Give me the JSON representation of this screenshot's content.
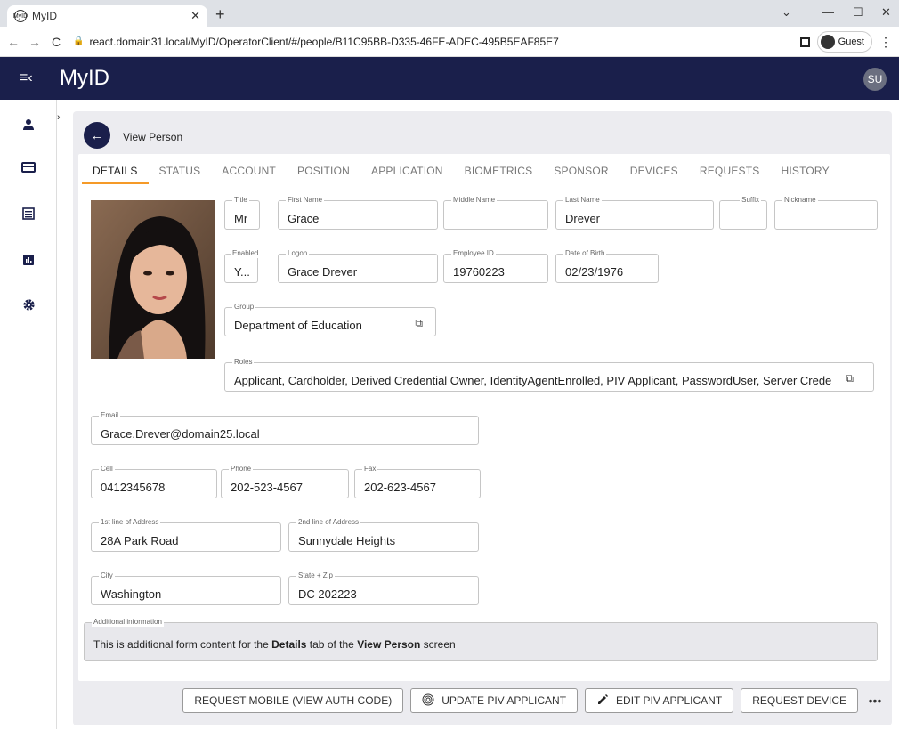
{
  "browser": {
    "tab_title": "MyID",
    "favicon_text": "MyID",
    "url": "react.domain31.local/MyID/OperatorClient/#/people/B11C95BB-D335-46FE-ADEC-495B5EAF85E7",
    "profile_label": "Guest"
  },
  "appbar": {
    "brand": "MyID",
    "user_initials": "SU"
  },
  "page": {
    "title": "View Person"
  },
  "tabs": [
    "DETAILS",
    "STATUS",
    "ACCOUNT",
    "POSITION",
    "APPLICATION",
    "BIOMETRICS",
    "SPONSOR",
    "DEVICES",
    "REQUESTS",
    "HISTORY"
  ],
  "fields": {
    "title": {
      "label": "Title",
      "value": "Mr"
    },
    "first_name": {
      "label": "First Name",
      "value": "Grace"
    },
    "middle_name": {
      "label": "Middle Name",
      "value": ""
    },
    "last_name": {
      "label": "Last Name",
      "value": "Drever"
    },
    "suffix": {
      "label": "Suffix",
      "value": ""
    },
    "nickname": {
      "label": "Nickname",
      "value": ""
    },
    "enabled": {
      "label": "Enabled",
      "value": "Y..."
    },
    "logon": {
      "label": "Logon",
      "value": "Grace Drever"
    },
    "employee_id": {
      "label": "Employee ID",
      "value": "19760223"
    },
    "dob": {
      "label": "Date of Birth",
      "value": "02/23/1976"
    },
    "group": {
      "label": "Group",
      "value": "Department of Education"
    },
    "roles": {
      "label": "Roles",
      "value": "Applicant, Cardholder, Derived Credential Owner, IdentityAgentEnrolled, PIV Applicant, PasswordUser, Server Crede"
    },
    "email": {
      "label": "Email",
      "value": "Grace.Drever@domain25.local"
    },
    "cell": {
      "label": "Cell",
      "value": "0412345678"
    },
    "phone": {
      "label": "Phone",
      "value": "202-523-4567"
    },
    "fax": {
      "label": "Fax",
      "value": "202-623-4567"
    },
    "address1": {
      "label": "1st line of Address",
      "value": "28A Park Road"
    },
    "address2": {
      "label": "2nd line of Address",
      "value": "Sunnydale Heights"
    },
    "city": {
      "label": "City",
      "value": "Washington"
    },
    "state_zip": {
      "label": "State + Zip",
      "value": "DC 202223"
    }
  },
  "additional": {
    "label": "Additional information",
    "text_before": "This is additional form content for the ",
    "bold1": "Details",
    "text_mid": " tab of the ",
    "bold2": "View Person",
    "text_after": " screen"
  },
  "actions": {
    "request_mobile": "REQUEST MOBILE (VIEW AUTH CODE)",
    "update_piv": "UPDATE PIV APPLICANT",
    "edit_piv": "EDIT PIV APPLICANT",
    "request_device": "REQUEST DEVICE",
    "more": "•••"
  }
}
